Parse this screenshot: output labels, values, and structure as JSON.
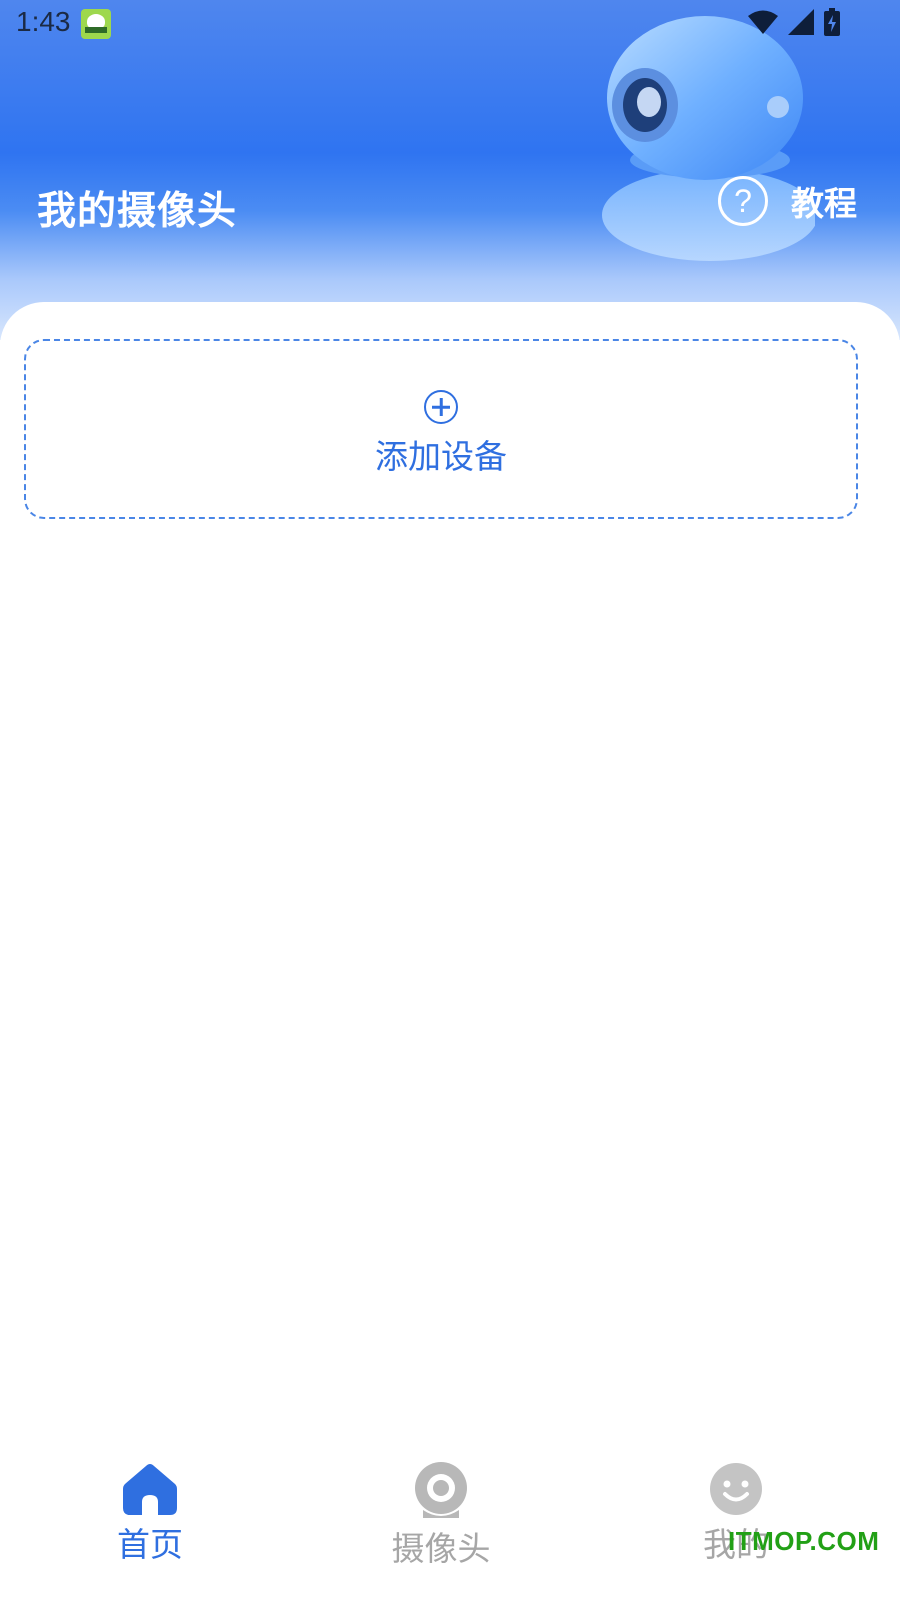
{
  "status_bar": {
    "time": "1:43"
  },
  "header": {
    "title": "我的摄像头",
    "tutorial_label": "教程"
  },
  "add_device": {
    "label": "添加设备"
  },
  "tabs": [
    {
      "label": "首页",
      "icon": "home-icon",
      "selected": true
    },
    {
      "label": "摄像头",
      "icon": "camera-icon",
      "selected": false
    },
    {
      "label": "我的",
      "icon": "smiley-face-icon",
      "selected": false
    }
  ],
  "watermark": "ITMOP.COM",
  "colors": {
    "accent": "#2f6fe0",
    "header_blue": "#2f74f1",
    "inactive_tab": "#a6a6a6"
  }
}
